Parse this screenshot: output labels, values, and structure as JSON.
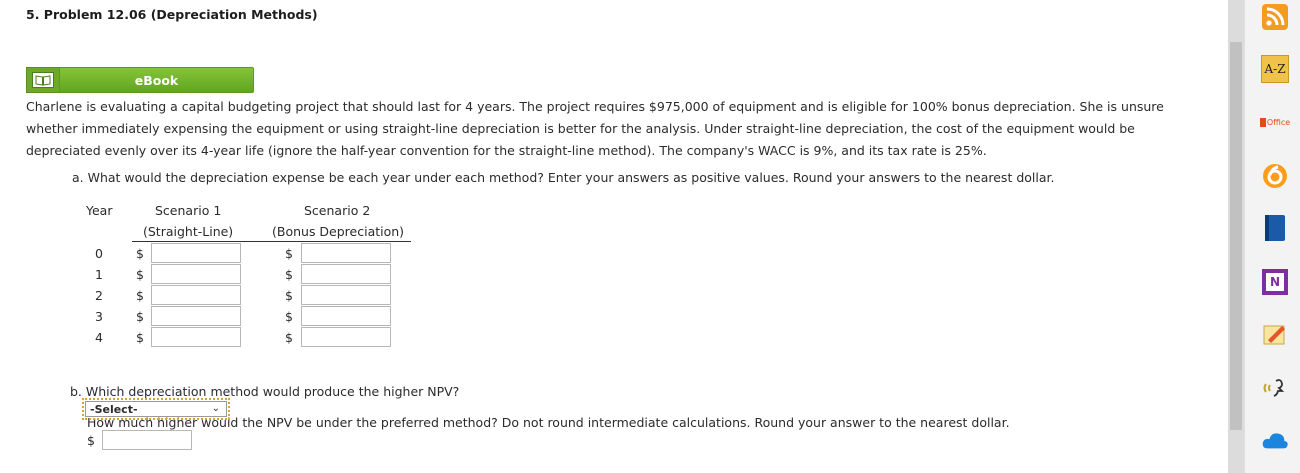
{
  "problem": {
    "title": "5. Problem 12.06 (Depreciation Methods)",
    "ebook_label": "eBook",
    "paragraph": [
      "Charlene is evaluating a capital budgeting project that should last for 4 years. The project requires $975,000 of equipment and is eligible for 100% bonus depreciation. She is unsure",
      "whether immediately expensing the equipment or using straight-line depreciation is better for the analysis. Under straight-line depreciation, the cost of the equipment would be",
      "depreciated evenly over its 4-year life (ignore the half-year convention for the straight-line method). The company's WACC is 9%, and its tax rate is 25%."
    ]
  },
  "part_a": {
    "question": "a. What would the depreciation expense be each year under each method? Enter your answers as positive values. Round your answers to the nearest dollar.",
    "col_year": "Year",
    "col_s1": "Scenario 1",
    "col_s1_sub": "(Straight-Line)",
    "col_s2": "Scenario 2",
    "col_s2_sub": "(Bonus Depreciation)",
    "currency": "$",
    "rows": [
      {
        "year": "0",
        "s1": "",
        "s2": ""
      },
      {
        "year": "1",
        "s1": "",
        "s2": ""
      },
      {
        "year": "2",
        "s1": "",
        "s2": ""
      },
      {
        "year": "3",
        "s1": "",
        "s2": ""
      },
      {
        "year": "4",
        "s1": "",
        "s2": ""
      }
    ]
  },
  "part_b": {
    "question": "b. Which depreciation method would produce the higher NPV?",
    "select_value": "-Select-",
    "question2": "How much higher would the NPV be under the preferred method? Do not round intermediate calculations. Round your answer to the nearest dollar.",
    "currency": "$",
    "answer": ""
  },
  "toolbar": {
    "icons": [
      "rss-icon",
      "a-z-icon",
      "office-icon",
      "blue-circle-icon",
      "book-icon",
      "onenote-icon",
      "notes-icon",
      "voice-icon",
      "cloud-icon"
    ],
    "az_label": "A-Z",
    "office_label": "Office",
    "onenote_label": "N"
  }
}
